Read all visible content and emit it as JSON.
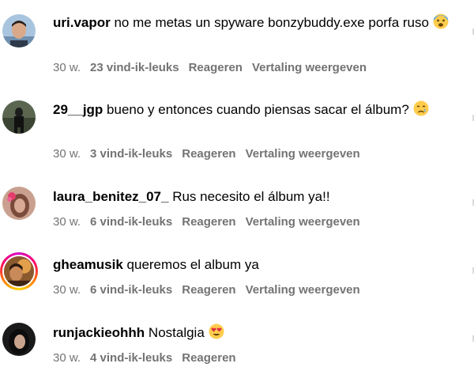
{
  "comments": [
    {
      "username": "uri.vapor",
      "text": " no me metas un spyware bonzybuddy.exe porfa ruso ",
      "emoji": "fearful-face-emoji",
      "time": "30 w.",
      "likes": "23 vind-ik-leuks",
      "reply": "Reageren",
      "translate": "Vertaling weergeven",
      "avatar_color": "#9bb7d4"
    },
    {
      "username": "29__jgp",
      "text": " bueno y entonces cuando piensas sacar el álbum? ",
      "emoji": "crying-face-emoji",
      "time": "30 w.",
      "likes": "3 vind-ik-leuks",
      "reply": "Reageren",
      "translate": "Vertaling weergeven",
      "avatar_color": "#3d4a35"
    },
    {
      "username": "laura_benitez_07_",
      "text": " Rus necesito el álbum ya!!",
      "time": "30 w.",
      "likes": "6 vind-ik-leuks",
      "reply": "Reageren",
      "translate": "Vertaling weergeven",
      "avatar_color": "#b5786a"
    },
    {
      "username": "gheamusik",
      "text": " queremos el album ya",
      "time": "30 w.",
      "likes": "6 vind-ik-leuks",
      "reply": "Reageren",
      "translate": "Vertaling weergeven",
      "avatar_color": "#c9823c"
    },
    {
      "username": "runjackieohhh",
      "text": " Nostalgia ",
      "emoji": "heart-eyes-emoji",
      "time": "30 w.",
      "likes": "4 vind-ik-leuks",
      "reply": "Reageren",
      "avatar_color": "#2a2a2a"
    }
  ],
  "colors": {
    "meta": "#737373",
    "story_ring": [
      "#d300c5",
      "#ff0069",
      "#ff7a00",
      "#ffd600"
    ]
  }
}
